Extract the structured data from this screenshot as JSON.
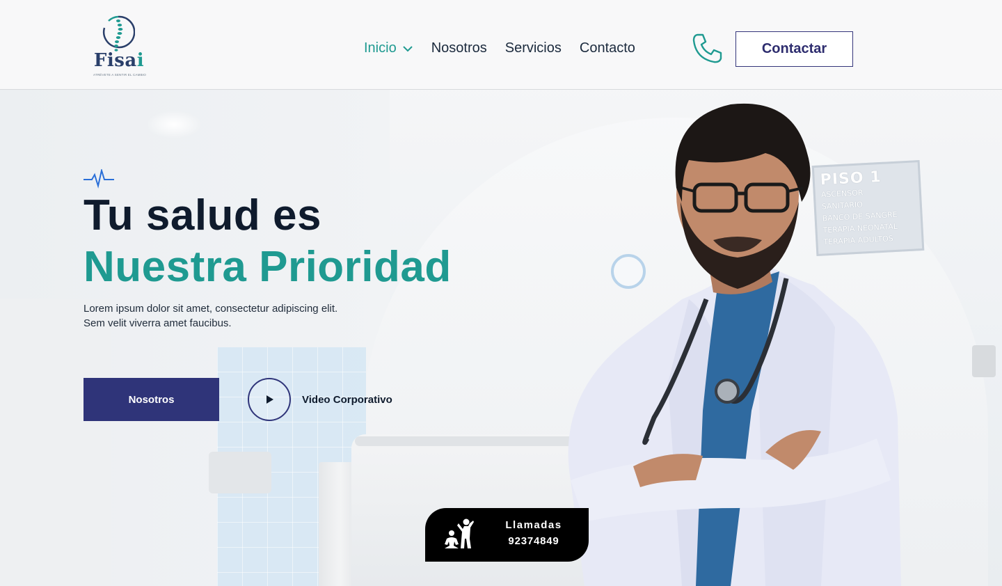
{
  "brand": {
    "name_main": "Fisa",
    "name_accent": "i",
    "tagline": "ATRÉVETE A SENTIR EL CAMBIO"
  },
  "nav": {
    "items": [
      {
        "label": "Inicio",
        "active": true
      },
      {
        "label": "Nosotros",
        "active": false
      },
      {
        "label": "Servicios",
        "active": false
      },
      {
        "label": "Contacto",
        "active": false
      }
    ],
    "contact_button": "Contactar"
  },
  "hero": {
    "title_line1": "Tu salud es",
    "title_line2": "Nuestra Prioridad",
    "desc_line1": "Lorem ipsum dolor sit amet, consectetur adipiscing elit.",
    "desc_line2": "Sem velit viverra amet faucibus.",
    "primary_button": "Nosotros",
    "video_label": "Video Corporativo"
  },
  "background_sign": {
    "title": "PISO 1",
    "lines": [
      "ASCENSOR",
      "SANITARIO",
      "BANCO DE SANGRE",
      "TERAPIA NEONATAL",
      "TERAPIA ADULTOS"
    ]
  },
  "calls": {
    "title": "Llamadas",
    "number": "92374849"
  },
  "colors": {
    "teal": "#1f9a91",
    "navy": "#2f3479",
    "dark": "#0f1b2d",
    "badge": "#000000"
  },
  "icons": {
    "nav_dropdown": "chevron-down-icon",
    "phone": "phone-icon",
    "pulse": "heartbeat-icon",
    "play": "play-icon",
    "calls": "people-care-icon"
  }
}
